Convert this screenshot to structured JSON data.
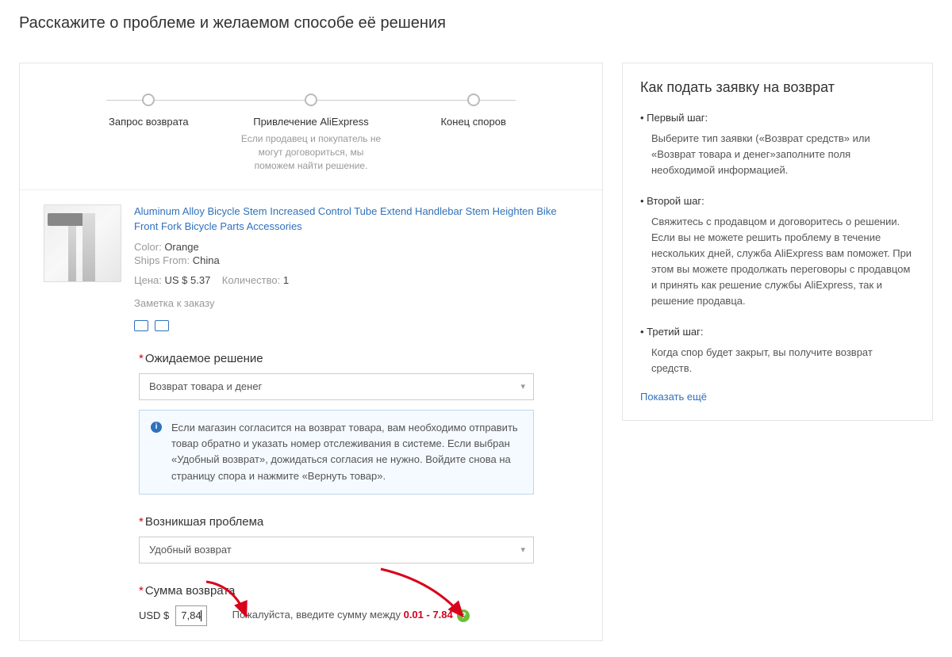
{
  "page_title": "Расскажите о проблеме и желаемом способе её решения",
  "steps": [
    {
      "title": "Запрос возврата",
      "sub": ""
    },
    {
      "title": "Привлечение AliExpress",
      "sub": "Если продавец и покупатель не могут договориться, мы поможем найти решение."
    },
    {
      "title": "Конец споров",
      "sub": ""
    }
  ],
  "product": {
    "title": "Aluminum Alloy Bicycle Stem Increased Control Tube Extend Handlebar Stem Heighten Bike Front Fork Bicycle Parts Accessories",
    "color_label": "Color:",
    "color_value": "Orange",
    "ships_label": "Ships From:",
    "ships_value": "China",
    "price_label": "Цена:",
    "price_value": "US $ 5.37",
    "qty_label": "Количество:",
    "qty_value": "1",
    "note_label": "Заметка к заказу"
  },
  "expected": {
    "label": "Ожидаемое решение",
    "selected": "Возврат товара и денег",
    "info": "Если магазин согласится на возврат товара, вам необходимо отправить товар обратно и указать номер отслеживания в системе. Если выбран «Удобный возврат», дожидаться согласия не нужно. Войдите снова на страницу спора и нажмите «Вернуть товар»."
  },
  "problem": {
    "label": "Возникшая проблема",
    "selected": "Удобный возврат"
  },
  "refund": {
    "label": "Сумма возврата",
    "currency": "USD $",
    "value": "7,84",
    "hint_prefix": "Пожалуйста, введите сумму между ",
    "range": "0.01 - 7.84"
  },
  "sidebar": {
    "title": "Как подать заявку на возврат",
    "steps": [
      {
        "head": "• Первый шаг:",
        "body": "Выберите тип заявки («Возврат средств» или «Возврат товара и денег»заполните поля необходимой информацией."
      },
      {
        "head": "• Второй шаг:",
        "body": "Свяжитесь с продавцом и договоритесь о решении. Если вы не можете решить проблему в течение нескольких дней, служба AliExpress вам поможет. При этом вы можете продолжать переговоры с продавцом и принять как решение службы AliExpress, так и решение продавца."
      },
      {
        "head": "• Третий шаг:",
        "body": "Когда спор будет закрыт, вы получите возврат средств."
      }
    ],
    "show_more": "Показать ещё"
  }
}
